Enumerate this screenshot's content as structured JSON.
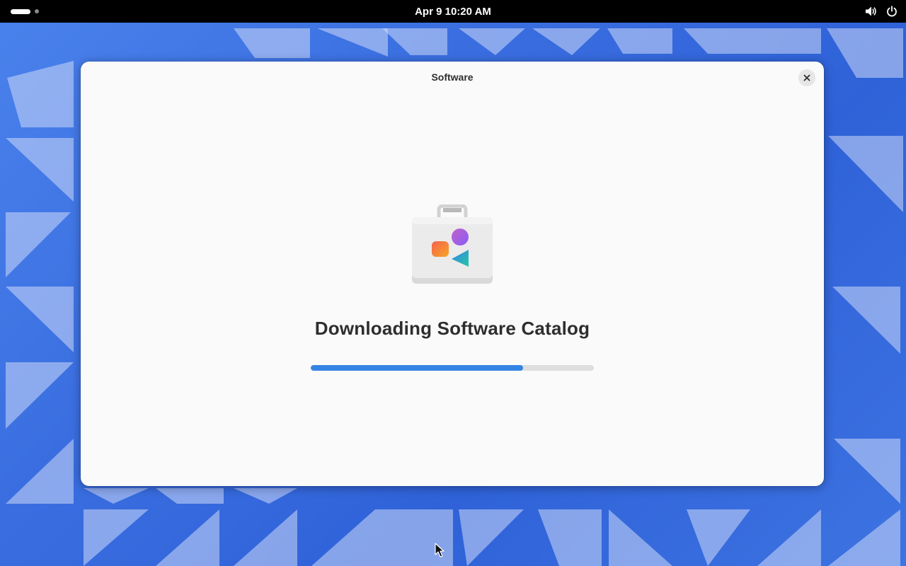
{
  "topbar": {
    "clock": "Apr 9  10:20 AM",
    "icons": [
      "activities-indicator",
      "volume-icon",
      "power-icon"
    ]
  },
  "window": {
    "title": "Software",
    "close_icon": "close-icon",
    "app_icon": "software-bag-icon",
    "status_title": "Downloading Software Catalog",
    "progress": 0.75
  },
  "colors": {
    "accent": "#3584e4",
    "window_bg": "#fafafa",
    "topbar_bg": "#000000",
    "wallpaper": "#3a6ee0"
  }
}
